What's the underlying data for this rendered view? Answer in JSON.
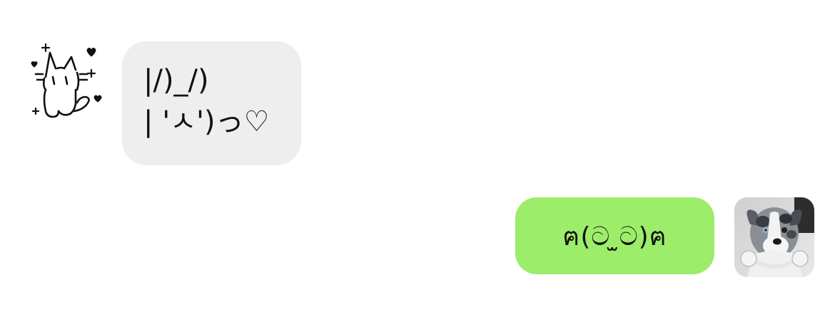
{
  "conversation": {
    "incoming": {
      "sender_avatar": "cat-doodle-avatar",
      "lines": [
        "|/)_/)",
        "| 'ㅅ')っ♡"
      ],
      "bubble_color": "#eeeeee"
    },
    "outgoing": {
      "sender_avatar": "dog-with-headphones-avatar",
      "text": "ฅ(ට ̫ට)ฅ",
      "bubble_color": "#9ced69"
    }
  }
}
